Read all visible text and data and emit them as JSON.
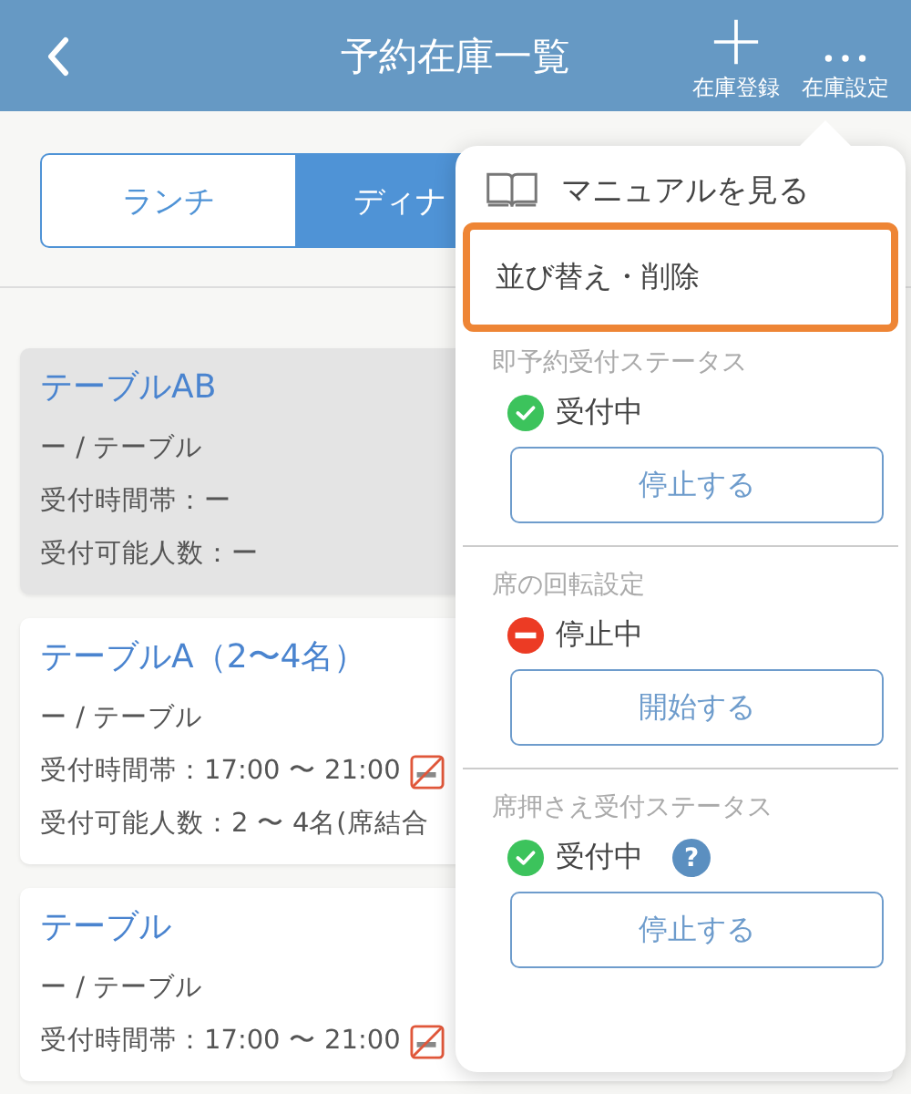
{
  "header": {
    "title": "予約在庫一覧",
    "actions": [
      {
        "kind": "add",
        "label": "在庫登録"
      },
      {
        "kind": "more",
        "label": "在庫設定"
      }
    ]
  },
  "tabs": [
    {
      "label": "ランチ",
      "selected": false
    },
    {
      "label": "ディナ",
      "selected": true
    }
  ],
  "cards": [
    {
      "title": "テーブルAB",
      "disabled": true,
      "lines": [
        {
          "text": "ー / テーブル",
          "no_smoking": false
        },
        {
          "text": "受付時間帯：ー",
          "no_smoking": false
        },
        {
          "text": "受付可能人数：ー",
          "no_smoking": false
        }
      ]
    },
    {
      "title": "テーブルA（2〜4名）",
      "disabled": false,
      "lines": [
        {
          "text": "ー / テーブル",
          "no_smoking": false
        },
        {
          "text": "受付時間帯：17:00 〜 21:00",
          "no_smoking": true
        },
        {
          "text": "受付可能人数：2 〜 4名(席結合",
          "no_smoking": false
        }
      ]
    },
    {
      "title": "テーブル",
      "disabled": false,
      "lines": [
        {
          "text": "ー / テーブル",
          "no_smoking": false
        },
        {
          "text": "受付時間帯：17:00 〜 21:00",
          "no_smoking": true
        }
      ]
    }
  ],
  "menu": {
    "manual": "マニュアルを見る",
    "sort": {
      "label": "並び替え・削除",
      "highlighted": true
    },
    "sections": [
      {
        "heading": "即予約受付ステータス",
        "status": "受付中",
        "kind": "accepting",
        "button": "停止する"
      },
      {
        "heading": "席の回転設定",
        "status": "停止中",
        "kind": "stopped",
        "button": "開始する"
      },
      {
        "heading": "席押さえ受付ステータス",
        "status": "受付中",
        "kind": "accepting",
        "help": "?",
        "button": "停止する"
      }
    ]
  }
}
